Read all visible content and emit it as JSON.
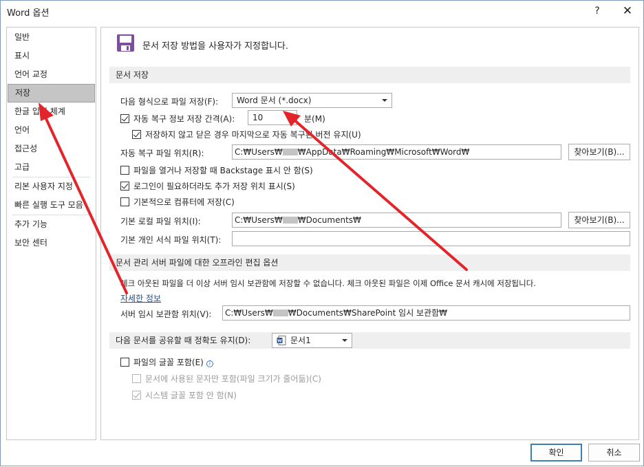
{
  "window": {
    "title": "Word 옵션",
    "help": "?",
    "close": "✕"
  },
  "nav": {
    "items": [
      {
        "label": "일반"
      },
      {
        "label": "표시"
      },
      {
        "label": "언어 교정"
      },
      {
        "label": "저장",
        "selected": true
      },
      {
        "label": "한글 입력 체계"
      },
      {
        "label": "언어"
      },
      {
        "label": "접근성"
      },
      {
        "label": "고급"
      },
      {
        "label": "리본 사용자 지정"
      },
      {
        "label": "빠른 실행 도구 모음"
      },
      {
        "label": "추가 기능"
      },
      {
        "label": "보안 센터"
      }
    ]
  },
  "header": {
    "icon": "save-icon",
    "text": "문서 저장 방법을 사용자가 지정합니다."
  },
  "save_section": {
    "title": "문서 저장",
    "format_label": "다음 형식으로 파일 저장(F):",
    "format_value": "Word 문서 (*.docx)",
    "autorecover_label": "자동 복구 정보 저장 간격(A):",
    "autorecover_checked": true,
    "autorecover_value": "10",
    "autorecover_unit": "분(M)",
    "keep_last_label": "저장하지 않고 닫은 경우 마지막으로 자동 복구된 버전 유지(U)",
    "keep_last_checked": true,
    "autorecover_location_label": "자동 복구 파일 위치(R):",
    "autorecover_location_prefix": "C:₩Users₩",
    "autorecover_location_suffix": "₩AppData₩Roaming₩Microsoft₩Word₩",
    "browse_label": "찾아보기(B)...",
    "no_backstage_label": "파일을 열거나 저장할 때 Backstage 표시 안 함(S)",
    "no_backstage_checked": false,
    "show_additional_label": "로그인이 필요하더라도 추가 저장 위치 표시(S)",
    "show_additional_checked": true,
    "save_computer_label": "기본적으로 컴퓨터에 저장(C)",
    "save_computer_checked": false,
    "default_local_label": "기본 로컬 파일 위치(I):",
    "default_local_prefix": "C:₩Users₩",
    "default_local_suffix": "₩Documents₩",
    "browse2_label": "찾아보기(B)...",
    "personal_templates_label": "기본 개인 서식 파일 위치(T):",
    "personal_templates_value": ""
  },
  "offline_section": {
    "title": "문서 관리 서버 파일에 대한 오프라인 편집 옵션",
    "notice": "체크 아웃된 파일을 더 이상 서버 임시 보관함에 저장할 수 없습니다. 체크 아웃된 파일은 이제 Office 문서 캐시에 저장됩니다.",
    "more_info": "자세한 정보",
    "server_drafts_label": "서버 임시 보관함 위치(V):",
    "server_drafts_prefix": "C:₩Users₩",
    "server_drafts_suffix": "₩Documents₩SharePoint 임시 보관함₩"
  },
  "fidelity_section": {
    "title": "다음 문서를 공유할 때 정확도 유지(D):",
    "document_value": "문서1",
    "embed_fonts_label": "파일의 글꼴 포함(E)",
    "embed_fonts_checked": false,
    "embed_used_label": "문서에 사용된 문자만 포함(파일 크기가 줄어듦)(C)",
    "embed_used_checked": false,
    "no_system_label": "시스템 글꼴 포함 안 함(N)",
    "no_system_checked": true
  },
  "footer": {
    "ok": "확인",
    "cancel": "취소"
  },
  "annotation_color": "#e3242b"
}
